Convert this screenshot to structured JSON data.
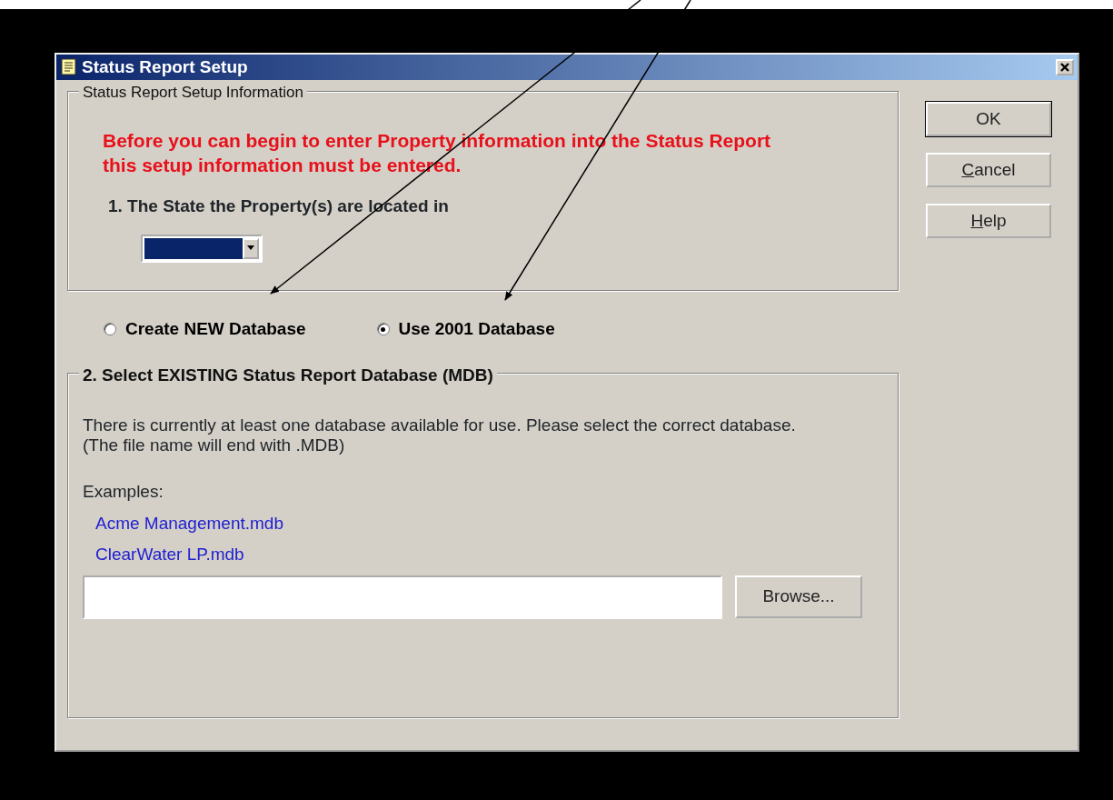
{
  "window": {
    "title": "Status Report Setup"
  },
  "setup_group": {
    "legend": "Status Report Setup Information",
    "warning": "Before you can begin to enter Property information into the Status Report this setup information must be entered.",
    "state_label": "1. The State the Property(s) are located in"
  },
  "database_options": [
    {
      "label": "Create NEW Database",
      "selected": false
    },
    {
      "label": "Use 2001 Database",
      "selected": true
    }
  ],
  "existing_group": {
    "legend": "2. Select EXISTING Status Report Database (MDB)",
    "description": "There is currently at least one database available for use. Please select the correct database. (The file name will end with .MDB)",
    "examples_label": "Examples:",
    "examples": [
      "Acme Management.mdb",
      "ClearWater LP.mdb"
    ],
    "browse_button": "Browse..."
  },
  "buttons": [
    {
      "label": "OK",
      "default": true
    },
    {
      "label": "Cancel",
      "default": false,
      "access_key_underlined": true
    },
    {
      "label": "Help",
      "default": false,
      "access_key_underlined": true
    }
  ]
}
